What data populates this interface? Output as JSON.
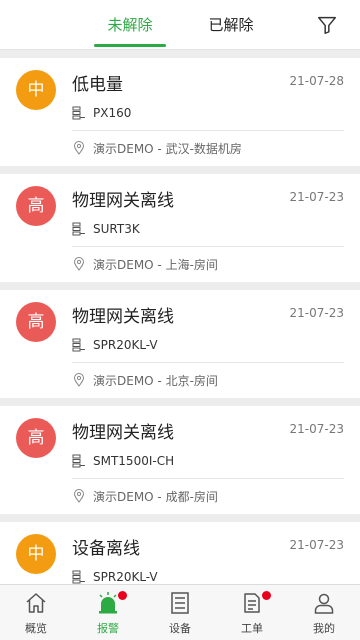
{
  "colors": {
    "accent": "#2eaa44",
    "high": "#ea5b58",
    "medium": "#f39c12",
    "badge": "#e8001c"
  },
  "tabs": [
    {
      "label": "未解除"
    },
    {
      "label": "已解除"
    }
  ],
  "alarms": [
    {
      "level": "中",
      "level_color": "#f39c12",
      "title": "低电量",
      "date": "21-07-28",
      "device": "PX160",
      "location": "演示DEMO - 武汉-数据机房"
    },
    {
      "level": "高",
      "level_color": "#ea5b58",
      "title": "物理网关离线",
      "date": "21-07-23",
      "device": "SURT3K",
      "location": "演示DEMO - 上海-房间"
    },
    {
      "level": "高",
      "level_color": "#ea5b58",
      "title": "物理网关离线",
      "date": "21-07-23",
      "device": "SPR20KL-V",
      "location": "演示DEMO - 北京-房间"
    },
    {
      "level": "高",
      "level_color": "#ea5b58",
      "title": "物理网关离线",
      "date": "21-07-23",
      "device": "SMT1500I-CH",
      "location": "演示DEMO - 成都-房间"
    },
    {
      "level": "中",
      "level_color": "#f39c12",
      "title": "设备离线",
      "date": "21-07-23",
      "device": "SPR20KL-V",
      "location": ""
    }
  ],
  "nav": [
    {
      "label": "概览",
      "icon": "home-icon"
    },
    {
      "label": "报警",
      "icon": "alarm-icon"
    },
    {
      "label": "设备",
      "icon": "device-icon"
    },
    {
      "label": "工单",
      "icon": "workorder-icon"
    },
    {
      "label": "我的",
      "icon": "user-icon"
    }
  ]
}
